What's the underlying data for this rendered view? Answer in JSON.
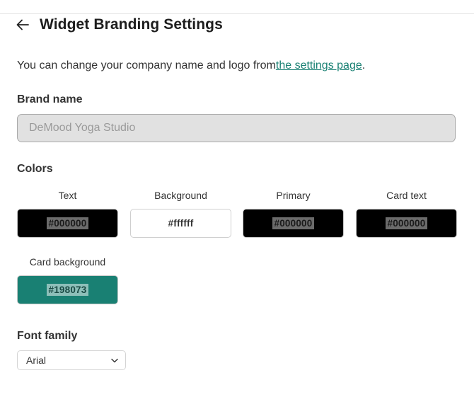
{
  "header": {
    "title": "Widget Branding Settings",
    "back_icon": "arrow-left-icon"
  },
  "intro": {
    "text": "You can change your company name and logo from",
    "link_text": "the settings page",
    "suffix": "."
  },
  "brand": {
    "label": "Brand name",
    "placeholder": "DeMood Yoga Studio"
  },
  "colors": {
    "label": "Colors",
    "items": [
      {
        "label": "Text",
        "value": "#000000"
      },
      {
        "label": "Background",
        "value": "#ffffff"
      },
      {
        "label": "Primary",
        "value": "#000000"
      },
      {
        "label": "Card text",
        "value": "#000000"
      },
      {
        "label": "Card background",
        "value": "#198073"
      }
    ]
  },
  "font": {
    "label": "Font family",
    "selected": "Arial",
    "chevron_icon": "chevron-down-icon"
  },
  "theme": {
    "accent": "#198073",
    "link": "#198073"
  }
}
